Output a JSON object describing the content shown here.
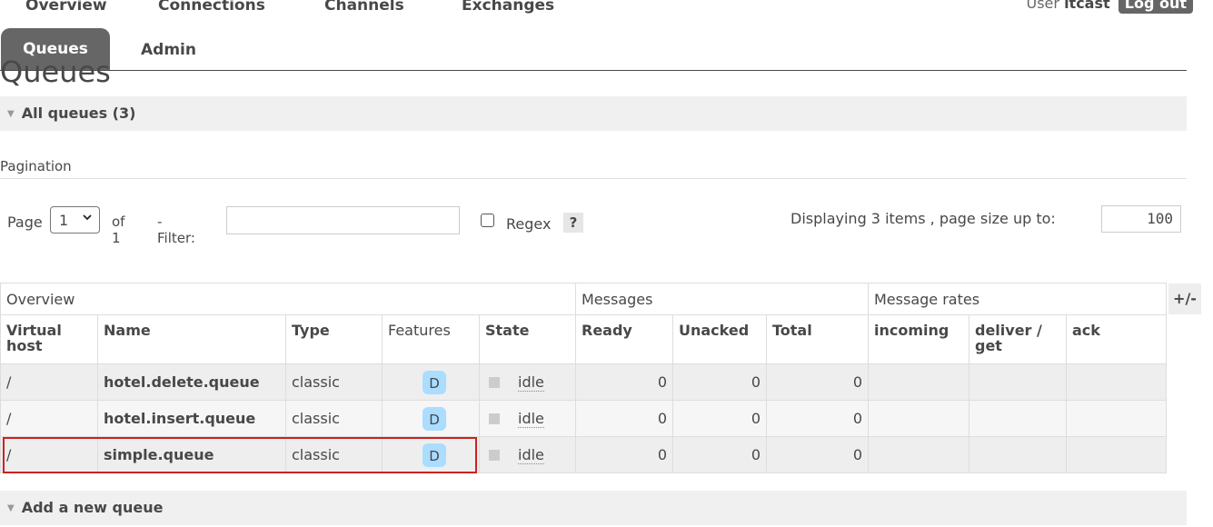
{
  "nav": {
    "items": [
      "Overview",
      "Connections",
      "Channels",
      "Exchanges",
      "Queues",
      "Admin"
    ],
    "active": "Queues"
  },
  "user": {
    "label": "User",
    "name": "itcast",
    "logout_label": "Log out"
  },
  "page_title": "Queues",
  "all_queues_label": "All queues (3)",
  "pagination": {
    "title": "Pagination",
    "page_label": "Page",
    "page_value": "1",
    "of_label": "of 1",
    "filter_label": "- Filter:",
    "filter_value": "",
    "regex_label": "Regex",
    "help_label": "?",
    "displaying": "Displaying 3 items , page size up to:",
    "page_size": "100"
  },
  "table": {
    "groups": [
      "Overview",
      "Messages",
      "Message rates"
    ],
    "toggle_columns_label": "+/-",
    "columns": {
      "vhost": "Virtual host",
      "name": "Name",
      "type": "Type",
      "features": "Features",
      "state": "State",
      "ready": "Ready",
      "unacked": "Unacked",
      "total": "Total",
      "incoming": "incoming",
      "deliver_get": "deliver / get",
      "ack": "ack"
    },
    "rows": [
      {
        "vhost": "/",
        "name": "hotel.delete.queue",
        "type": "classic",
        "feature": "D",
        "state": "idle",
        "ready": "0",
        "unacked": "0",
        "total": "0",
        "incoming": "",
        "deliver_get": "",
        "ack": ""
      },
      {
        "vhost": "/",
        "name": "hotel.insert.queue",
        "type": "classic",
        "feature": "D",
        "state": "idle",
        "ready": "0",
        "unacked": "0",
        "total": "0",
        "incoming": "",
        "deliver_get": "",
        "ack": ""
      },
      {
        "vhost": "/",
        "name": "simple.queue",
        "type": "classic",
        "feature": "D",
        "state": "idle",
        "ready": "0",
        "unacked": "0",
        "total": "0",
        "incoming": "",
        "deliver_get": "",
        "ack": ""
      }
    ]
  },
  "add_queue_label": "Add a new queue",
  "colors": {
    "active_tab": "#666666",
    "feature_badge": "#aaddff",
    "highlight": "#cc2222"
  }
}
